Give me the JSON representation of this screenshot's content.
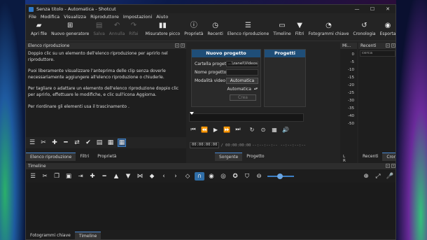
{
  "window": {
    "title": "Senza titolo - Automatica - Shotcut",
    "controls": {
      "minimize": "—",
      "maximize": "☐",
      "close": "✕"
    }
  },
  "menu": [
    "File",
    "Modifica",
    "Visualizza",
    "Riproduttore",
    "Impostazioni",
    "Aiuto"
  ],
  "toolbar": [
    {
      "label": "Apri file",
      "icon": "folder-open-icon",
      "glyph": "📂",
      "enabled": true
    },
    {
      "label": "Nuovo generatore",
      "icon": "generator-icon",
      "glyph": "⊞",
      "enabled": true
    },
    {
      "label": "Salva",
      "icon": "save-icon",
      "glyph": "▤",
      "enabled": false
    },
    {
      "label": "Annulla",
      "icon": "undo-icon",
      "glyph": "↶",
      "enabled": false
    },
    {
      "label": "Rifai",
      "icon": "redo-icon",
      "glyph": "↷",
      "enabled": false
    },
    {
      "label": "Misuratore picco",
      "icon": "peak-meter-icon",
      "glyph": "▮▮",
      "enabled": true
    },
    {
      "label": "Proprietà",
      "icon": "info-icon",
      "glyph": "ⓘ",
      "enabled": true
    },
    {
      "label": "Recenti",
      "icon": "clock-icon",
      "glyph": "◷",
      "enabled": true
    },
    {
      "label": "Elenco riproduzione",
      "icon": "playlist-icon",
      "glyph": "☰",
      "enabled": true
    },
    {
      "label": "Timeline",
      "icon": "timeline-icon",
      "glyph": "▭",
      "enabled": true
    },
    {
      "label": "Filtri",
      "icon": "filter-icon",
      "glyph": "⏷",
      "enabled": true
    },
    {
      "label": "Fotogrammi chiave",
      "icon": "stopwatch-icon",
      "glyph": "⏱",
      "enabled": true
    },
    {
      "label": "Cronologia",
      "icon": "history-icon",
      "glyph": "↺",
      "enabled": true
    },
    {
      "label": "Esporta",
      "icon": "export-icon",
      "glyph": "◉",
      "enabled": true
    }
  ],
  "playlist": {
    "header": "Elenco riproduzione",
    "p1": "Doppio clic su un elemento dell'elenco riproduzione per aprirlo nel riproduttore.",
    "p2": "Puoi liberamente visualizzare l'anteprima delle clip senza doverle necessariamente aggiungere all'elenco riproduzione o chiuderle.",
    "p3": "Per tagliare o adattare un elemento dell'elenco riproduzione doppio clic per aprirlo, effettuare le modifiche, e clic sull'icona Aggiorna.",
    "p4": "Per riordinare gli elementi usa il trascinamento .",
    "tabs": [
      "Elenco riproduzione",
      "Filtri",
      "Proprietà"
    ]
  },
  "new_project": {
    "title": "Nuovo progetto",
    "folder_label": "Cartella progetti",
    "folder_value": "...\\zanel\\Videos",
    "name_label": "Nome progetto",
    "name_value": "",
    "mode_label": "Modalità video",
    "mode_value": "Automatica",
    "mode_value2": "Automatica",
    "create_label": "Crea"
  },
  "projects": {
    "title": "Progetti"
  },
  "player": {
    "timecode_in": "00:00:00:00",
    "timecode_dur": "/ 00:00:00:00",
    "in_point": "--:--:--:--",
    "out_point": "--:--:--:--",
    "tabs": [
      "Sorgente",
      "Progetto"
    ]
  },
  "meter": {
    "header": "Mi...",
    "ticks": [
      "0",
      "-5",
      "-10",
      "-15",
      "-20",
      "-25",
      "-30",
      "-35",
      "-40",
      "-50"
    ],
    "channels": "L R"
  },
  "recent": {
    "header": "Recenti",
    "search_placeholder": "cerca",
    "tabs": [
      "Recenti",
      "Cronologia"
    ]
  },
  "timeline": {
    "header": "Timeline",
    "tabs": [
      "Fotogrammi chiave",
      "Timeline"
    ]
  }
}
